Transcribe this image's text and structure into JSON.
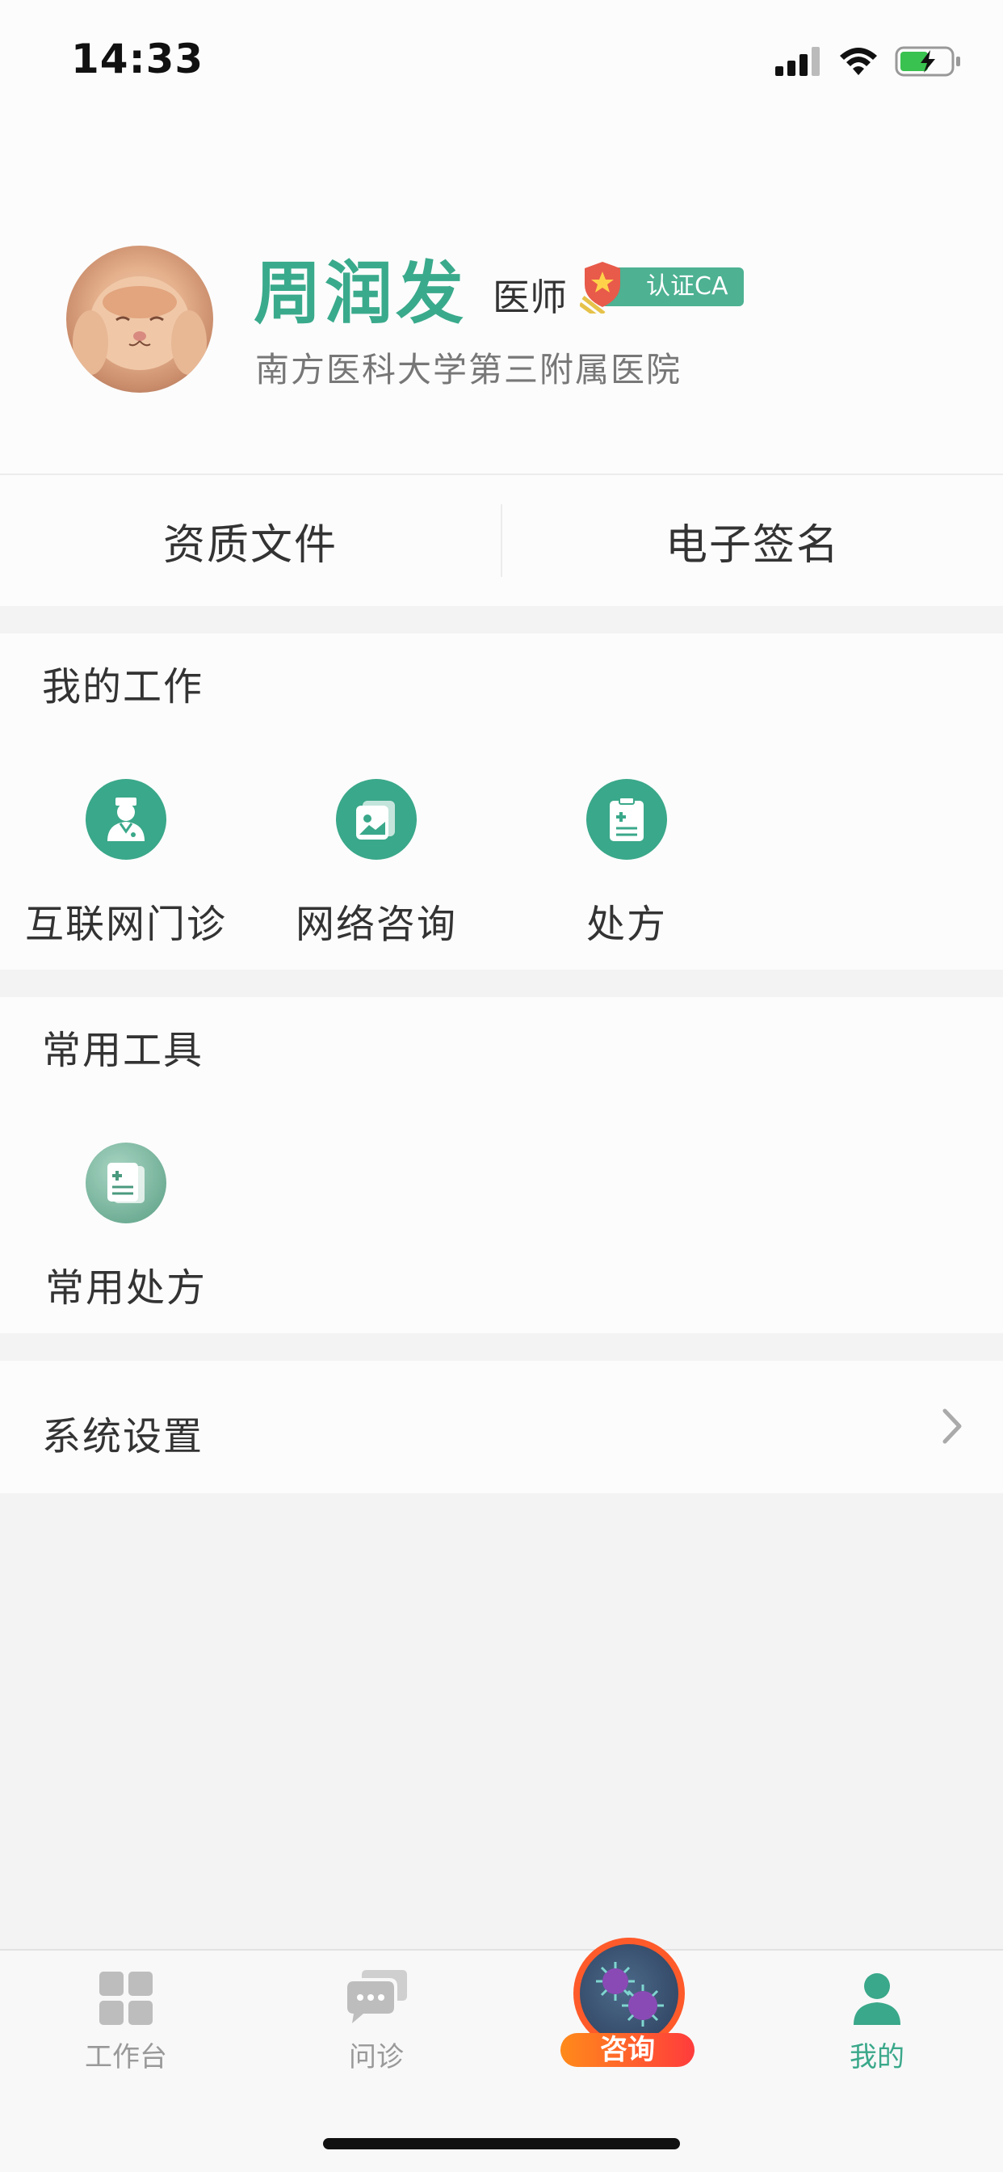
{
  "status_bar": {
    "time": "14:33"
  },
  "profile": {
    "name": "周润发",
    "title": "医师",
    "badge": "认证CA",
    "hospital": "南方医科大学第三附属医院"
  },
  "documents": {
    "qualification": "资质文件",
    "signature": "电子签名"
  },
  "my_work": {
    "title": "我的工作",
    "items": [
      {
        "label": "互联网门诊",
        "icon": "doctor-icon"
      },
      {
        "label": "网络咨询",
        "icon": "consult-card-icon"
      },
      {
        "label": "处方",
        "icon": "prescription-icon"
      }
    ]
  },
  "tools": {
    "title": "常用工具",
    "items": [
      {
        "label": "常用处方",
        "icon": "prescription-stack-icon"
      }
    ]
  },
  "settings": {
    "label": "系统设置"
  },
  "tabbar": {
    "items": [
      {
        "label": "工作台",
        "icon": "grid-icon"
      },
      {
        "label": "问诊",
        "icon": "chat-icon"
      },
      {
        "label": "咨询",
        "icon": "virus-icon"
      },
      {
        "label": "我的",
        "icon": "person-icon",
        "active": true
      }
    ]
  },
  "colors": {
    "accent": "#3aa88a",
    "badge": "#4db192",
    "consult_orange": "#ff5a2a"
  }
}
